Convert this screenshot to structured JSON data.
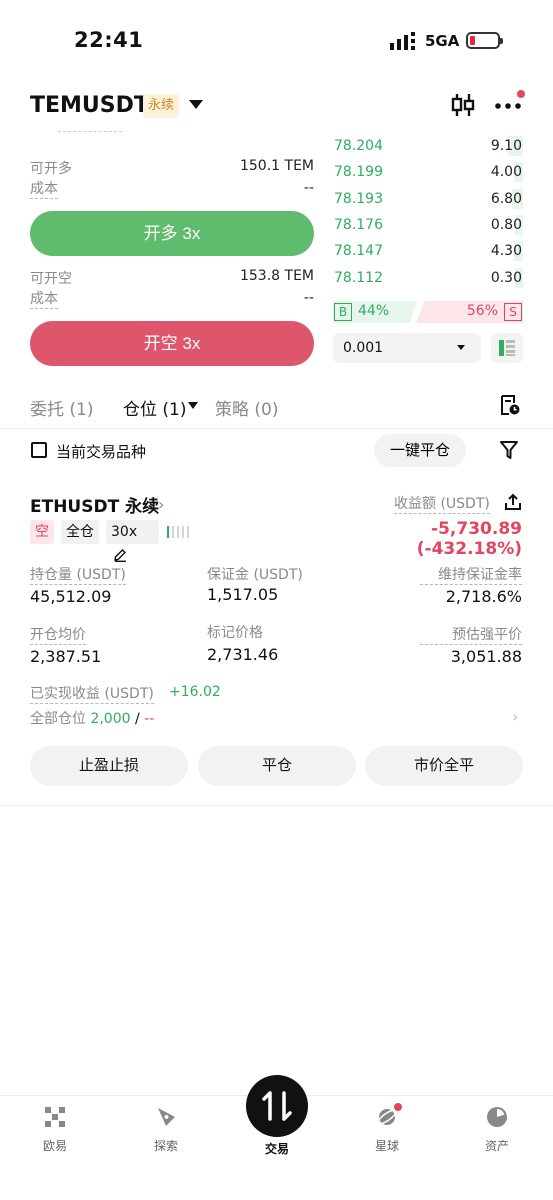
{
  "status_bar": {
    "time": "22:41",
    "network": "5GA"
  },
  "header": {
    "symbol": "TEMUSDT",
    "contract_tag": "永续"
  },
  "order_form": {
    "long_available_label": "可开多",
    "long_available_value": "150.1 TEM",
    "long_cost_label": "成本",
    "long_cost_value": "--",
    "long_button": "开多 3x",
    "short_available_label": "可开空",
    "short_available_value": "153.8 TEM",
    "short_cost_label": "成本",
    "short_cost_value": "--",
    "short_button": "开空 3x"
  },
  "orderbook": {
    "bids": [
      {
        "price": "78.204",
        "qty": "9.10",
        "depth": 0.08
      },
      {
        "price": "78.199",
        "qty": "4.00",
        "depth": 0.05
      },
      {
        "price": "78.193",
        "qty": "6.80",
        "depth": 0.06
      },
      {
        "price": "78.176",
        "qty": "0.80",
        "depth": 0.04
      },
      {
        "price": "78.147",
        "qty": "4.30",
        "depth": 0.05
      },
      {
        "price": "78.112",
        "qty": "0.30",
        "depth": 0.04
      }
    ],
    "buy_tag": "B",
    "buy_pct": "44%",
    "sell_pct": "56%",
    "sell_tag": "S",
    "depth_step": "0.001"
  },
  "tabs": {
    "orders": "委托 (1)",
    "positions": "仓位 (1)",
    "strategies": "策略 (0)"
  },
  "filter_bar": {
    "current_symbol_label": "当前交易品种",
    "close_all_button": "一键平仓"
  },
  "position": {
    "title": "ETHUSDT 永续",
    "pnl_label": "收益额 (USDT)",
    "side": "空",
    "margin_mode": "全仓",
    "leverage": "30x",
    "pnl_value": "-5,730.89 (-432.18%)",
    "size_label": "持仓量 (USDT)",
    "size_value": "45,512.09",
    "margin_label": "保证金 (USDT)",
    "margin_value": "1,517.05",
    "mmr_label": "维持保证金率",
    "mmr_value": "2,718.6%",
    "entry_label": "开仓均价",
    "entry_value": "2,387.51",
    "mark_label": "标记价格",
    "mark_value": "2,731.46",
    "liq_label": "预估强平价",
    "liq_value": "3,051.88",
    "realized_label": "已实现收益 (USDT)",
    "realized_value": "+16.02",
    "all_positions_label": "全部仓位",
    "all_positions_value": "2,000",
    "all_positions_sep": " / ",
    "all_positions_rest": "--",
    "tpsl_button": "止盈止损",
    "close_button": "平仓",
    "market_close_button": "市价全平"
  },
  "bottom_nav": {
    "home": "欧易",
    "discover": "探索",
    "trade": "交易",
    "planet": "星球",
    "assets": "资产"
  },
  "colors": {
    "green": "#2fae5f",
    "red": "#e2465f",
    "long_button": "#5fbb6d",
    "short_button": "#dd566b",
    "tag_bg": "#fdf1dc"
  }
}
